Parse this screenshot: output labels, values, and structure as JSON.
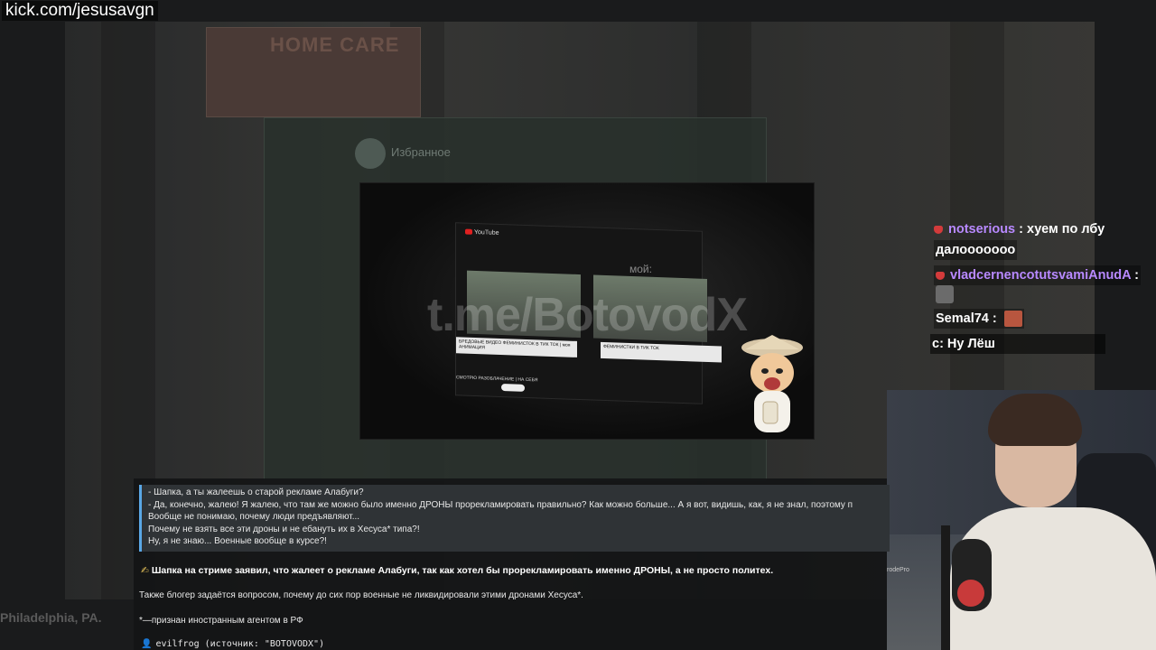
{
  "stream": {
    "url": "kick.com/jesusavgn",
    "background_sign": "HOME CARE",
    "background_window_title": "Избранное",
    "background_city": "Philadelphia, PA."
  },
  "video": {
    "site_logo": "YouTube",
    "overlay_word": "мой:",
    "watermark": "t.me/BotovodX",
    "card1_caption": "БРЕДОВЫЕ ВИДЕО ФЕМИНИСТОК В ТИК ТОК | моя АНИМАЦИЯ",
    "card2_caption": "ФЕМИНИСТКИ В ТИК ТОК",
    "bottom_title": "СМОТРЮ РАЗОБЛАЧЕНИЕ | НА СЕБЯ"
  },
  "chat": {
    "messages": [
      {
        "user": "notserious",
        "text": "хуем по лбу"
      },
      {
        "user": "",
        "text": "далооооооо"
      },
      {
        "user": "vladcernencotutsvamiAnudA",
        "text": ""
      },
      {
        "user": "Semal74",
        "text": ""
      },
      {
        "user": "",
        "text": "с: Ну Лёш"
      }
    ],
    "separator": " : "
  },
  "news": {
    "quote_lines": [
      "- Шапка, а ты жалеешь о старой рекламе Алабуги?",
      "- Да, конечно, жалею! Я жалею, что там же можно было именно ДРОНЫ прорекламировать правильно? Как можно больше... А я вот, видишь, как, я не знал, поэтому п",
      "Вообще не понимаю, почему люди предъявляют...",
      "Почему не взять все эти дроны и не ебануть их в Хесуса* типа?!",
      "Ну, я не знаю... Военные вообще в курсе?!"
    ],
    "headline": "Шапка на стриме заявил, что жалеет о рекламе Алабуги, так как хотел бы прорекламировать именно ДРОНЫ, а не просто политех.",
    "paragraph2": "Также блогер задаётся вопросом, почему до сих пор военные не ликвидировали этими дронами Хесуса*.",
    "paragraph3": "*—признан иностранным агентом в РФ",
    "source": "evilfrog (источник: \"BOTOVODX\")"
  },
  "webcam": {
    "mic_label": "rodePro"
  },
  "colors": {
    "chat_username": "#b889ff",
    "quote_border": "#5aa7e6",
    "background": "#1a1b1c"
  }
}
